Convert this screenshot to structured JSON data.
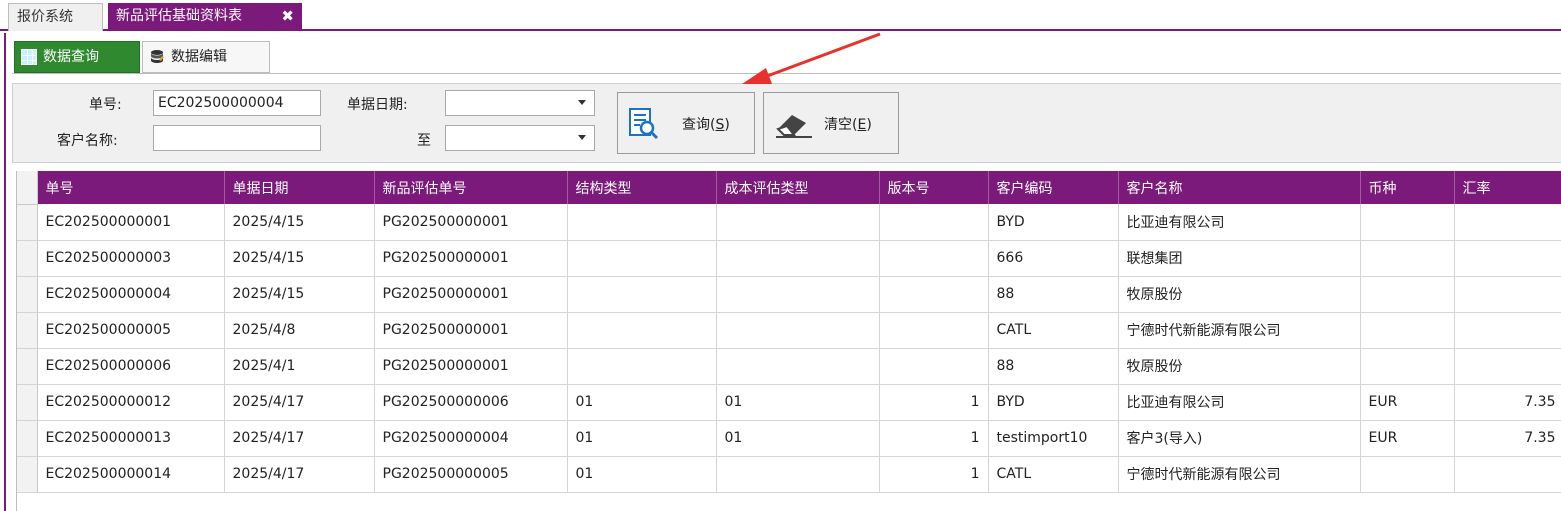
{
  "doc_tabs": [
    {
      "label": "报价系统"
    },
    {
      "label": "新品评估基础资料表",
      "close": "✖"
    }
  ],
  "sub_tabs": [
    {
      "label": "数据查询"
    },
    {
      "label": "数据编辑"
    }
  ],
  "query": {
    "order_no_label": "单号:",
    "order_no_value": "EC202500000004",
    "date_label": "单据日期:",
    "date_from_value": "",
    "to_label": "至",
    "date_to_value": "",
    "customer_label": "客户名称:",
    "customer_value": "",
    "search_label": "查询(",
    "search_key": "S",
    "search_suffix": ")",
    "clear_label": "清空(",
    "clear_key": "E",
    "clear_suffix": ")"
  },
  "table": {
    "columns": [
      "单号",
      "单据日期",
      "新品评估单号",
      "结构类型",
      "成本评估类型",
      "版本号",
      "客户编码",
      "客户名称",
      "币种",
      "汇率"
    ],
    "rows": [
      [
        "EC202500000001",
        "2025/4/15",
        "PG202500000001",
        "",
        "",
        "",
        "BYD",
        "比亚迪有限公司",
        "",
        ""
      ],
      [
        "EC202500000003",
        "2025/4/15",
        "PG202500000001",
        "",
        "",
        "",
        "666",
        "联想集团",
        "",
        ""
      ],
      [
        "EC202500000004",
        "2025/4/15",
        "PG202500000001",
        "",
        "",
        "",
        "88",
        "牧原股份",
        "",
        ""
      ],
      [
        "EC202500000005",
        "2025/4/8",
        "PG202500000001",
        "",
        "",
        "",
        "CATL",
        "宁德时代新能源有限公司",
        "",
        ""
      ],
      [
        "EC202500000006",
        "2025/4/1",
        "PG202500000001",
        "",
        "",
        "",
        "88",
        "牧原股份",
        "",
        ""
      ],
      [
        "EC202500000012",
        "2025/4/17",
        "PG202500000006",
        "01",
        "01",
        "1",
        "BYD",
        "比亚迪有限公司",
        "EUR",
        "7.35"
      ],
      [
        "EC202500000013",
        "2025/4/17",
        "PG202500000004",
        "01",
        "01",
        "1",
        "testimport10",
        "客户3(导入)",
        "EUR",
        "7.35"
      ],
      [
        "EC202500000014",
        "2025/4/17",
        "PG202500000005",
        "01",
        "",
        "1",
        "CATL",
        "宁德时代新能源有限公司",
        "",
        ""
      ]
    ]
  },
  "colors": {
    "accent": "#7b1a7b",
    "active_subtab": "#2f8a2f",
    "annotation_arrow": "#e8312a"
  },
  "icons": {
    "grid": "grid-icon",
    "database": "database-icon",
    "search": "search-document-icon",
    "eraser": "eraser-icon"
  }
}
